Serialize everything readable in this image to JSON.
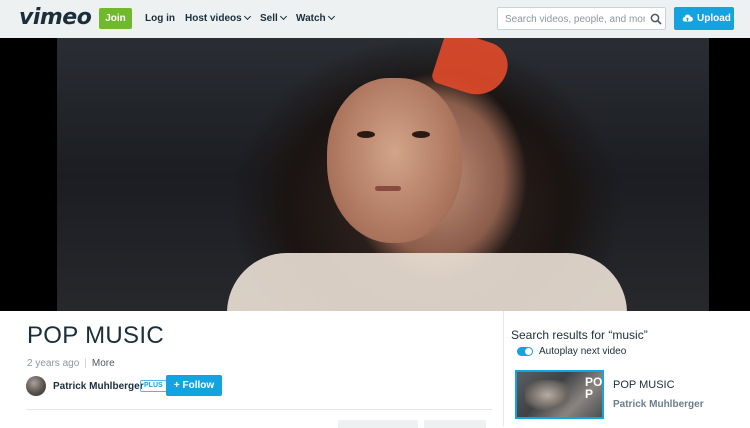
{
  "header": {
    "logo": "vimeo",
    "join_label": "Join",
    "login_label": "Log in",
    "host_videos_label": "Host videos",
    "sell_label": "Sell",
    "watch_label": "Watch",
    "search_placeholder": "Search videos, people, and more",
    "upload_label": "Upload"
  },
  "video": {
    "title": "POP MUSIC",
    "age": "2 years ago",
    "more_label": "More",
    "author": "Patrick Muhlberger",
    "author_badge": "PLUS",
    "follow_label": "+ Follow"
  },
  "sidebar": {
    "title": "Search results for “music”",
    "autoplay_label": "Autoplay next video",
    "autoplay_on": true,
    "results": [
      {
        "title": "POP MUSIC",
        "author": "Patrick Muhlberger",
        "thumb_text": "PO\nP"
      }
    ]
  },
  "colors": {
    "accent": "#13a3e0",
    "join_green": "#70b92c",
    "text_dark": "#1a2e3b",
    "nav_bg": "#eef1f2"
  }
}
